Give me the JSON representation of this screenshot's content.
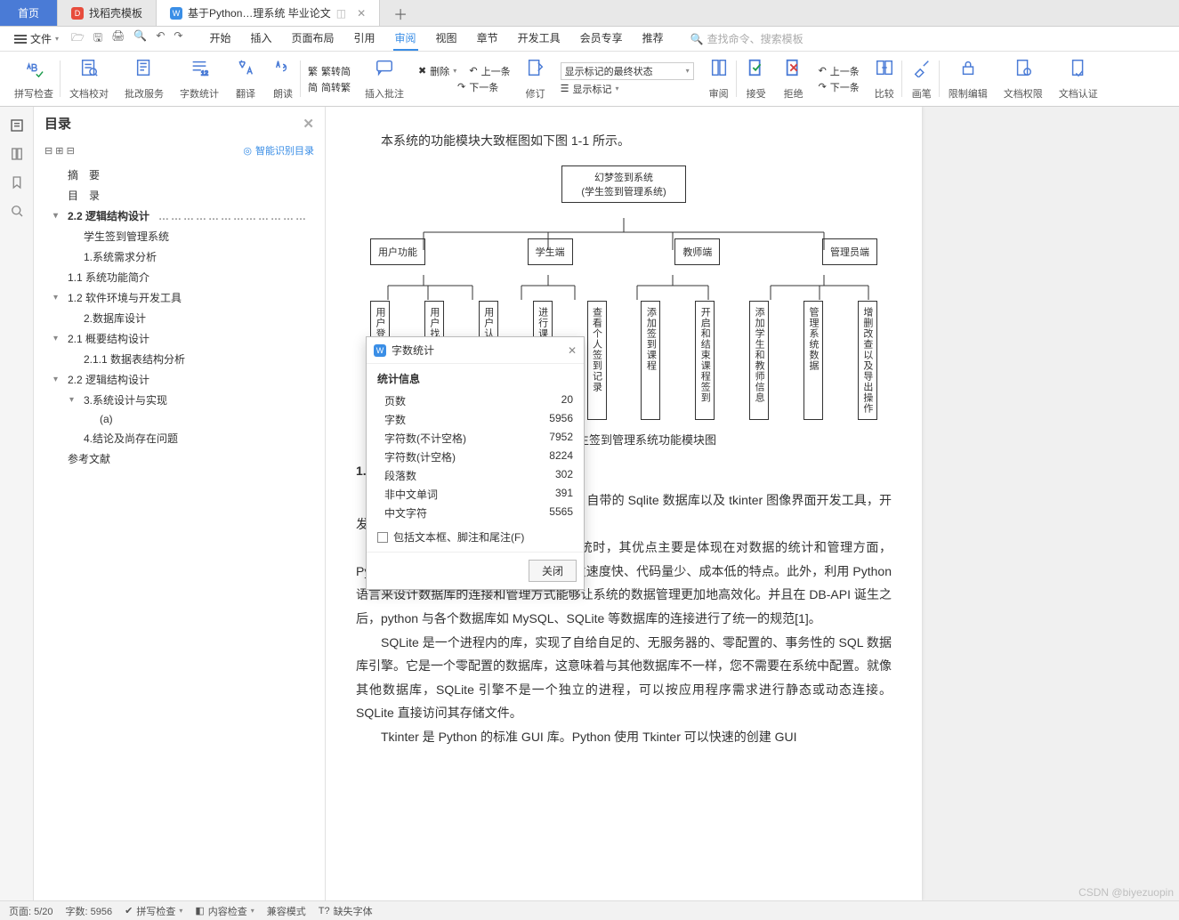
{
  "tabs": {
    "home": "首页",
    "t1": "找稻壳模板",
    "t2_prefix": "基于Python…理系统 毕业论文",
    "pinned_icon": "◫"
  },
  "menubar": {
    "file": "文件",
    "items": [
      "开始",
      "插入",
      "页面布局",
      "引用",
      "审阅",
      "视图",
      "章节",
      "开发工具",
      "会员专享",
      "推荐"
    ],
    "active": "审阅",
    "search_placeholder": "查找命令、搜索模板"
  },
  "ribbon": {
    "g": [
      "拼写检查",
      "文档校对",
      "批改服务",
      "字数统计",
      "翻译",
      "朗读"
    ],
    "conv_top": "繁转简",
    "conv_bot": "简转繁",
    "insert_comment": "插入批注",
    "delete": "删除",
    "prev": "上一条",
    "next": "下一条",
    "edit": "修订",
    "mark_select": "显示标记的最终状态",
    "show_marks": "显示标记",
    "review": "审阅",
    "accept": "接受",
    "reject": "拒绝",
    "prev_change": "上一条",
    "next_change": "下一条",
    "compare": "比较",
    "brush": "画笔",
    "restrict": "限制编辑",
    "doc_perm": "文档权限",
    "doc_auth": "文档认证"
  },
  "outline": {
    "title": "目录",
    "ai": "智能识别目录",
    "items": [
      {
        "lvl": 1,
        "caret": "",
        "text": "摘　要"
      },
      {
        "lvl": 1,
        "caret": "",
        "text": "目　录"
      },
      {
        "lvl": 1,
        "caret": "v",
        "text": "2.2 逻辑结构设计",
        "dotted": true,
        "active": true
      },
      {
        "lvl": 2,
        "caret": "",
        "text": "学生签到管理系统"
      },
      {
        "lvl": 2,
        "caret": "",
        "text": "1.系统需求分析"
      },
      {
        "lvl": 1,
        "caret": "",
        "text": "1.1 系统功能简介"
      },
      {
        "lvl": 1,
        "caret": "v",
        "text": "1.2 软件环境与开发工具"
      },
      {
        "lvl": 2,
        "caret": "",
        "text": "2.数据库设计"
      },
      {
        "lvl": 1,
        "caret": "v",
        "text": "2.1 概要结构设计"
      },
      {
        "lvl": 2,
        "caret": "",
        "text": "2.1.1 数据表结构分析"
      },
      {
        "lvl": 1,
        "caret": "v",
        "text": "2.2 逻辑结构设计"
      },
      {
        "lvl": 2,
        "caret": "v",
        "text": "3.系统设计与实现"
      },
      {
        "lvl": 3,
        "caret": "",
        "text": "(a)"
      },
      {
        "lvl": 2,
        "caret": "",
        "text": "4.结论及尚存在问题"
      },
      {
        "lvl": 1,
        "caret": "",
        "text": "参考文献"
      }
    ]
  },
  "doc": {
    "intro": "本系统的功能模块大致框图如下图 1-1 所示。",
    "root_l1": "幻梦签到系统",
    "root_l2": "(学生签到管理系统)",
    "row2": [
      "用户功能",
      "学生端",
      "教师端",
      "管理员端"
    ],
    "leaves": [
      "用户登录和注册",
      "用户找回和修改密码",
      "用户认证身份信息",
      "进行课程签到",
      "查看个人签到记录",
      "添加签到课程",
      "开启和结束课程签到",
      "添加学生和教师信息",
      "管理系统数据",
      "增删改查以及导出操作"
    ],
    "caption": "图 1-1  学生签到管理系统功能模块图",
    "s12": "1.2 软件环境与开发工具",
    "p1": "本系统使用的是 Python 3.8、Python 自带的 Sqlite 数据库以及 tkinter 图像界面开发工具，开发环境是 Spyder 4.1.4。",
    "p2": "Python 语言在设计学生签到管理系统时，其优点主要是体现在对数据的统计和管理方面，Python 的特性让它在处理数据时拥有开发速度快、代码量少、成本低的特点。此外，利用 Python 语言来设计数据库的连接和管理方式能够让系统的数据管理更加地高效化。并且在 DB-API 诞生之后，python 与各个数据库如 MySQL、SQLite 等数据库的连接进行了统一的规范[1]。",
    "p3": "SQLite 是一个进程内的库，实现了自给自足的、无服务器的、零配置的、事务性的 SQL 数据库引擎。它是一个零配置的数据库，这意味着与其他数据库不一样，您不需要在系统中配置。就像其他数据库，SQLite 引擎不是一个独立的进程，可以按应用程序需求进行静态或动态连接。SQLite 直接访问其存储文件。",
    "p4": "Tkinter 是 Python 的标准 GUI 库。Python 使用 Tkinter 可以快速的创建 GUI"
  },
  "dialog": {
    "title": "字数统计",
    "section": "统计信息",
    "rows": [
      [
        "页数",
        "20"
      ],
      [
        "字数",
        "5956"
      ],
      [
        "字符数(不计空格)",
        "7952"
      ],
      [
        "字符数(计空格)",
        "8224"
      ],
      [
        "段落数",
        "302"
      ],
      [
        "非中文单词",
        "391"
      ],
      [
        "中文字符",
        "5565"
      ]
    ],
    "checkbox": "包括文本框、脚注和尾注(F)",
    "close_btn": "关闭"
  },
  "status": {
    "page": "页面: 5/20",
    "words": "字数: 5956",
    "spell": "拼写检查",
    "content": "内容检查",
    "compat": "兼容模式",
    "missing_font": "缺失字体"
  },
  "watermark": "CSDN @biyezuopin"
}
